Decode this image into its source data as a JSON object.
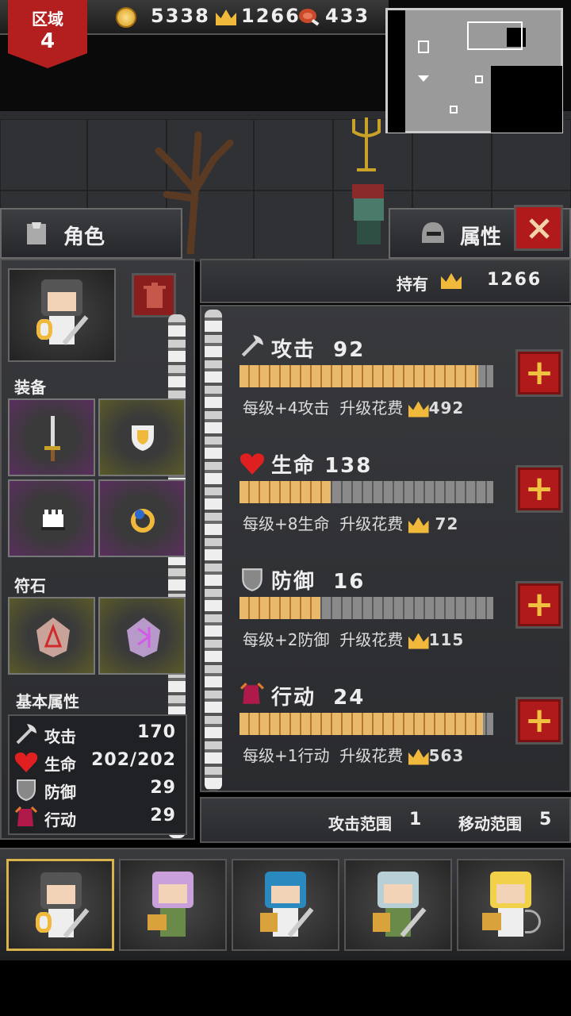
{
  "topbar": {
    "zone_label": "区域",
    "zone_number": "4",
    "gold": "5338",
    "crowns": "1266",
    "food": "433"
  },
  "left_panel": {
    "tab_label": "角色",
    "equipment_label": "装备",
    "runes_label": "符石",
    "basic_attrs_label": "基本属性",
    "basic_attrs": [
      {
        "label": "攻击",
        "value": "170",
        "icon": "axe-icon"
      },
      {
        "label": "生命",
        "value": "202/202",
        "icon": "heart-icon"
      },
      {
        "label": "防御",
        "value": "29",
        "icon": "shield-icon"
      },
      {
        "label": "行动",
        "value": "29",
        "icon": "boot-icon"
      }
    ]
  },
  "right_panel": {
    "tab_label": "属性",
    "owned_label": "持有",
    "owned_value": "1266",
    "attributes": [
      {
        "name": "攻击",
        "value": "92",
        "icon": "axe-icon",
        "per_level": "每级+4攻击",
        "cost_label": "升级花费",
        "cost": "492",
        "progress": 0.94
      },
      {
        "name": "生命",
        "value": "138",
        "icon": "heart-icon",
        "per_level": "每级+8生命",
        "cost_label": "升级花费",
        "cost": " 72",
        "progress": 0.36
      },
      {
        "name": "防御",
        "value": "16",
        "icon": "shield-icon",
        "per_level": "每级+2防御",
        "cost_label": "升级花费",
        "cost": "115",
        "progress": 0.32
      },
      {
        "name": "行动",
        "value": "24",
        "icon": "boot-icon",
        "per_level": "每级+1行动",
        "cost_label": "升级花费",
        "cost": "563",
        "progress": 0.96
      }
    ],
    "attack_range_label": "攻击范围",
    "attack_range": "1",
    "move_range_label": "移动范围",
    "move_range": "5"
  },
  "colors": {
    "accent_red": "#b01a1a",
    "gold": "#f1b93c",
    "bar_fill": "#e8b96a"
  }
}
